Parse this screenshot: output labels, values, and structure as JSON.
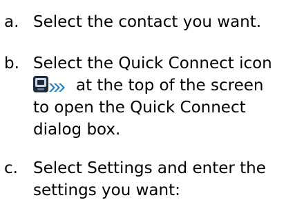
{
  "steps": [
    {
      "marker": "a.",
      "lines": [
        "Select the contact you want."
      ]
    },
    {
      "marker": "b.",
      "lines": [
        "Select the Quick Connect icon",
        "at the top of the screen",
        "to open the Quick Connect",
        "dialog box."
      ],
      "inline_icon": "quick-connect-icon"
    },
    {
      "marker": "c.",
      "lines": [
        "Select Settings and enter the",
        "settings you want:"
      ]
    }
  ]
}
